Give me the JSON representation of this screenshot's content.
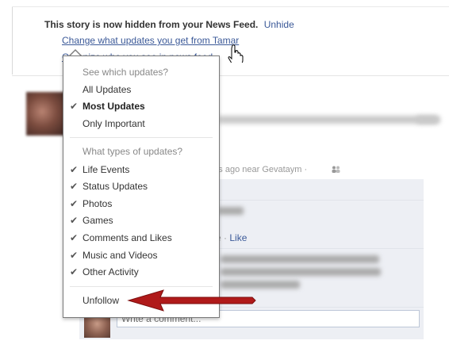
{
  "notice": {
    "hidden_message": "This story is now hidden from your News Feed.",
    "unhide_label": "Unhide",
    "change_updates_link": "Change what updates you get from Tamar",
    "organize_link": "Organize who you see in news feed"
  },
  "post": {
    "timestamp": "utes ago near Gevataym ·",
    "mobile_text": "bile ·",
    "like_label": "Like"
  },
  "comment": {
    "placeholder": "Write a comment..."
  },
  "menu": {
    "section1_header": "See which updates?",
    "section1_items": [
      {
        "label": "All Updates",
        "checked": false,
        "bold": false
      },
      {
        "label": "Most Updates",
        "checked": true,
        "bold": true
      },
      {
        "label": "Only Important",
        "checked": false,
        "bold": false
      }
    ],
    "section2_header": "What types of updates?",
    "section2_items": [
      {
        "label": "Life Events",
        "checked": true
      },
      {
        "label": "Status Updates",
        "checked": true
      },
      {
        "label": "Photos",
        "checked": true
      },
      {
        "label": "Games",
        "checked": true
      },
      {
        "label": "Comments and Likes",
        "checked": true
      },
      {
        "label": "Music and Videos",
        "checked": true
      },
      {
        "label": "Other Activity",
        "checked": true
      }
    ],
    "unfollow_label": "Unfollow",
    "check_glyph": "✔"
  },
  "colors": {
    "link": "#3b5998",
    "arrow": "#b01a1a"
  }
}
